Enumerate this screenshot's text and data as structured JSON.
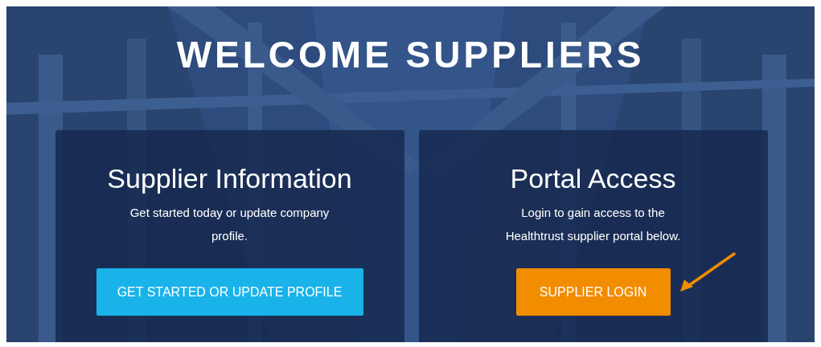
{
  "banner": {
    "title": "WELCOME SUPPLIERS"
  },
  "cards": [
    {
      "heading": "Supplier Information",
      "text": "Get started today or update company profile.",
      "button": {
        "label": "GET STARTED OR UPDATE PROFILE",
        "kind": "primary"
      },
      "pointer_arrow": false
    },
    {
      "heading": "Portal Access",
      "text": "Login to gain access to the Healthtrust supplier portal below.",
      "button": {
        "label": "SUPPLIER LOGIN",
        "kind": "accent"
      },
      "pointer_arrow": true
    }
  ]
}
